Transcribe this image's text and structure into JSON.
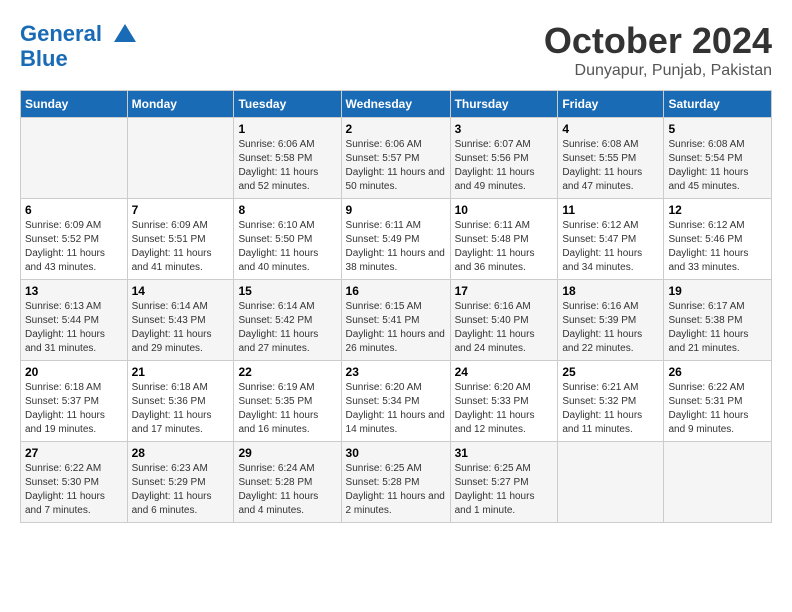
{
  "header": {
    "logo_line1": "General",
    "logo_line2": "Blue",
    "month_title": "October 2024",
    "location": "Dunyapur, Punjab, Pakistan"
  },
  "days_of_week": [
    "Sunday",
    "Monday",
    "Tuesday",
    "Wednesday",
    "Thursday",
    "Friday",
    "Saturday"
  ],
  "weeks": [
    [
      {
        "day": "",
        "info": ""
      },
      {
        "day": "",
        "info": ""
      },
      {
        "day": "1",
        "info": "Sunrise: 6:06 AM\nSunset: 5:58 PM\nDaylight: 11 hours and 52 minutes."
      },
      {
        "day": "2",
        "info": "Sunrise: 6:06 AM\nSunset: 5:57 PM\nDaylight: 11 hours and 50 minutes."
      },
      {
        "day": "3",
        "info": "Sunrise: 6:07 AM\nSunset: 5:56 PM\nDaylight: 11 hours and 49 minutes."
      },
      {
        "day": "4",
        "info": "Sunrise: 6:08 AM\nSunset: 5:55 PM\nDaylight: 11 hours and 47 minutes."
      },
      {
        "day": "5",
        "info": "Sunrise: 6:08 AM\nSunset: 5:54 PM\nDaylight: 11 hours and 45 minutes."
      }
    ],
    [
      {
        "day": "6",
        "info": "Sunrise: 6:09 AM\nSunset: 5:52 PM\nDaylight: 11 hours and 43 minutes."
      },
      {
        "day": "7",
        "info": "Sunrise: 6:09 AM\nSunset: 5:51 PM\nDaylight: 11 hours and 41 minutes."
      },
      {
        "day": "8",
        "info": "Sunrise: 6:10 AM\nSunset: 5:50 PM\nDaylight: 11 hours and 40 minutes."
      },
      {
        "day": "9",
        "info": "Sunrise: 6:11 AM\nSunset: 5:49 PM\nDaylight: 11 hours and 38 minutes."
      },
      {
        "day": "10",
        "info": "Sunrise: 6:11 AM\nSunset: 5:48 PM\nDaylight: 11 hours and 36 minutes."
      },
      {
        "day": "11",
        "info": "Sunrise: 6:12 AM\nSunset: 5:47 PM\nDaylight: 11 hours and 34 minutes."
      },
      {
        "day": "12",
        "info": "Sunrise: 6:12 AM\nSunset: 5:46 PM\nDaylight: 11 hours and 33 minutes."
      }
    ],
    [
      {
        "day": "13",
        "info": "Sunrise: 6:13 AM\nSunset: 5:44 PM\nDaylight: 11 hours and 31 minutes."
      },
      {
        "day": "14",
        "info": "Sunrise: 6:14 AM\nSunset: 5:43 PM\nDaylight: 11 hours and 29 minutes."
      },
      {
        "day": "15",
        "info": "Sunrise: 6:14 AM\nSunset: 5:42 PM\nDaylight: 11 hours and 27 minutes."
      },
      {
        "day": "16",
        "info": "Sunrise: 6:15 AM\nSunset: 5:41 PM\nDaylight: 11 hours and 26 minutes."
      },
      {
        "day": "17",
        "info": "Sunrise: 6:16 AM\nSunset: 5:40 PM\nDaylight: 11 hours and 24 minutes."
      },
      {
        "day": "18",
        "info": "Sunrise: 6:16 AM\nSunset: 5:39 PM\nDaylight: 11 hours and 22 minutes."
      },
      {
        "day": "19",
        "info": "Sunrise: 6:17 AM\nSunset: 5:38 PM\nDaylight: 11 hours and 21 minutes."
      }
    ],
    [
      {
        "day": "20",
        "info": "Sunrise: 6:18 AM\nSunset: 5:37 PM\nDaylight: 11 hours and 19 minutes."
      },
      {
        "day": "21",
        "info": "Sunrise: 6:18 AM\nSunset: 5:36 PM\nDaylight: 11 hours and 17 minutes."
      },
      {
        "day": "22",
        "info": "Sunrise: 6:19 AM\nSunset: 5:35 PM\nDaylight: 11 hours and 16 minutes."
      },
      {
        "day": "23",
        "info": "Sunrise: 6:20 AM\nSunset: 5:34 PM\nDaylight: 11 hours and 14 minutes."
      },
      {
        "day": "24",
        "info": "Sunrise: 6:20 AM\nSunset: 5:33 PM\nDaylight: 11 hours and 12 minutes."
      },
      {
        "day": "25",
        "info": "Sunrise: 6:21 AM\nSunset: 5:32 PM\nDaylight: 11 hours and 11 minutes."
      },
      {
        "day": "26",
        "info": "Sunrise: 6:22 AM\nSunset: 5:31 PM\nDaylight: 11 hours and 9 minutes."
      }
    ],
    [
      {
        "day": "27",
        "info": "Sunrise: 6:22 AM\nSunset: 5:30 PM\nDaylight: 11 hours and 7 minutes."
      },
      {
        "day": "28",
        "info": "Sunrise: 6:23 AM\nSunset: 5:29 PM\nDaylight: 11 hours and 6 minutes."
      },
      {
        "day": "29",
        "info": "Sunrise: 6:24 AM\nSunset: 5:28 PM\nDaylight: 11 hours and 4 minutes."
      },
      {
        "day": "30",
        "info": "Sunrise: 6:25 AM\nSunset: 5:28 PM\nDaylight: 11 hours and 2 minutes."
      },
      {
        "day": "31",
        "info": "Sunrise: 6:25 AM\nSunset: 5:27 PM\nDaylight: 11 hours and 1 minute."
      },
      {
        "day": "",
        "info": ""
      },
      {
        "day": "",
        "info": ""
      }
    ]
  ]
}
